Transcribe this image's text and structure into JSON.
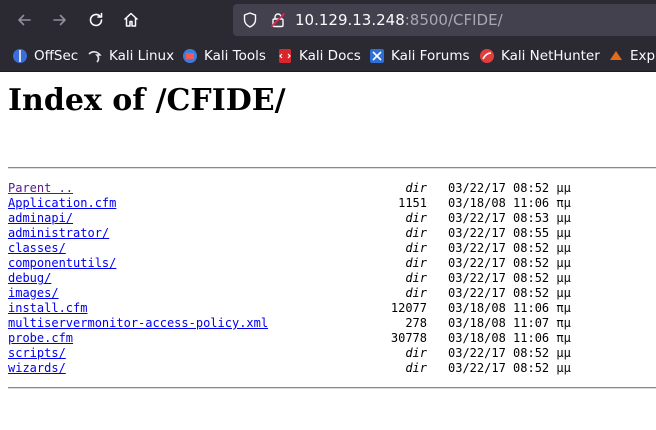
{
  "browser": {
    "url_host": "10.129.13.248",
    "url_path": ":8500/CFIDE/",
    "bookmarks": [
      {
        "label": "OffSec",
        "icon": "offsec-icon",
        "color": "#3b6ed9"
      },
      {
        "label": "Kali Linux",
        "icon": "kali-dragon-icon",
        "color": "#e8e8e8"
      },
      {
        "label": "Kali Tools",
        "icon": "kali-tools-icon",
        "color": "#3c7ee0"
      },
      {
        "label": "Kali Docs",
        "icon": "kali-docs-icon",
        "color": "#d9262d"
      },
      {
        "label": "Kali Forums",
        "icon": "kali-forums-icon",
        "color": "#2c6fd6"
      },
      {
        "label": "Kali NetHunter",
        "icon": "kali-nethunter-icon",
        "color": "#e23d3d"
      },
      {
        "label": "Expl",
        "icon": "exploit-db-icon",
        "color": "#e56a1a"
      }
    ]
  },
  "page": {
    "title": "Index of /CFIDE/",
    "entries": [
      {
        "name": "Parent ..",
        "size": "dir",
        "date": "03/22/17 08:52 μμ",
        "visited": true
      },
      {
        "name": "Application.cfm",
        "size": "1151",
        "date": "03/18/08 11:06 πμ"
      },
      {
        "name": "adminapi/",
        "size": "dir",
        "date": "03/22/17 08:53 μμ"
      },
      {
        "name": "administrator/",
        "size": "dir",
        "date": "03/22/17 08:55 μμ"
      },
      {
        "name": "classes/",
        "size": "dir",
        "date": "03/22/17 08:52 μμ"
      },
      {
        "name": "componentutils/",
        "size": "dir",
        "date": "03/22/17 08:52 μμ"
      },
      {
        "name": "debug/",
        "size": "dir",
        "date": "03/22/17 08:52 μμ"
      },
      {
        "name": "images/",
        "size": "dir",
        "date": "03/22/17 08:52 μμ"
      },
      {
        "name": "install.cfm",
        "size": "12077",
        "date": "03/18/08 11:06 πμ"
      },
      {
        "name": "multiservermonitor-access-policy.xml",
        "size": "278",
        "date": "03/18/08 11:07 πμ"
      },
      {
        "name": "probe.cfm",
        "size": "30778",
        "date": "03/18/08 11:06 πμ"
      },
      {
        "name": "scripts/",
        "size": "dir",
        "date": "03/22/17 08:52 μμ"
      },
      {
        "name": "wizards/",
        "size": "dir",
        "date": "03/22/17 08:52 μμ"
      }
    ]
  }
}
